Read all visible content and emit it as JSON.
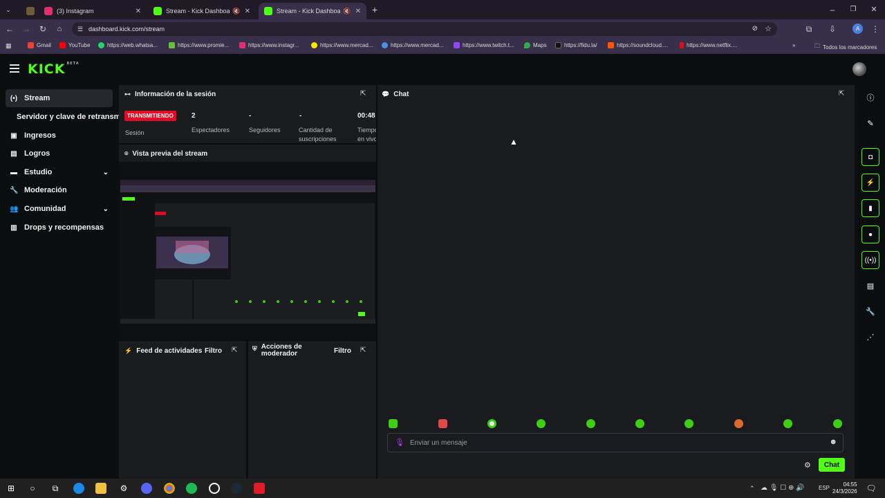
{
  "browser": {
    "tabs": [
      {
        "title": "(3) Instagram",
        "favicon_color": "#e1306c"
      },
      {
        "title": "Stream - Kick Dashboard",
        "favicon_color": "#53fc18"
      },
      {
        "title": "Stream - Kick Dashboard",
        "favicon_color": "#53fc18"
      }
    ],
    "url": "dashboard.kick.com/stream",
    "bookmarks": [
      {
        "label": "Gmail",
        "color": "#ea4335"
      },
      {
        "label": "YouTube",
        "color": "#ff0000"
      },
      {
        "label": "https://web.whatsa...",
        "color": "#25d366"
      },
      {
        "label": "https://www.promie...",
        "color": "#6abf3a"
      },
      {
        "label": "https://www.instagr...",
        "color": "#e1306c"
      },
      {
        "label": "https://www.mercad...",
        "color": "#ffe600"
      },
      {
        "label": "https://www.mercad...",
        "color": "#4a90e2"
      },
      {
        "label": "https://www.twitch.t...",
        "color": "#9146ff"
      },
      {
        "label": "Maps",
        "color": "#34a853"
      },
      {
        "label": "https://fidu.la/",
        "color": "#111111"
      },
      {
        "label": "https://soundcloud....",
        "color": "#ff5500"
      },
      {
        "label": "https://www.netflix....",
        "color": "#e50914"
      }
    ],
    "all_bookmarks": "Todos los marcadores"
  },
  "app": {
    "logo": "KICK",
    "logo_badge": "BETA",
    "accent": "#53fc18",
    "sidebar": {
      "stream": "Stream",
      "stream_sub": "Servidor y clave de retransm",
      "ingresos": "Ingresos",
      "logros": "Logros",
      "estudio": "Estudio",
      "moderacion": "Moderación",
      "comunidad": "Comunidad",
      "drops": "Drops y recompensas"
    },
    "session": {
      "title": "Información de la sesión",
      "status": "TRANSMITIENDO",
      "status_label": "Sesión",
      "viewers_value": "2",
      "viewers_label": "Espectadores",
      "followers_value": "-",
      "followers_label": "Seguidores",
      "subs_value": "-",
      "subs_label": "Cantidad de suscripciones",
      "time_value": "00:48",
      "time_label": "Tiempo en vivo"
    },
    "preview": {
      "title": "Vista previa del stream"
    },
    "activity": {
      "title": "Feed de actividades",
      "filter": "Filtro"
    },
    "modactions": {
      "title": "Acciones de moderador",
      "filter": "Filtro"
    },
    "chat": {
      "title": "Chat",
      "placeholder": "Enviar un mensaje",
      "send": "Chat"
    }
  },
  "taskbar": {
    "lang": "ESP",
    "time": "04:55",
    "date": "24/3/2026"
  }
}
